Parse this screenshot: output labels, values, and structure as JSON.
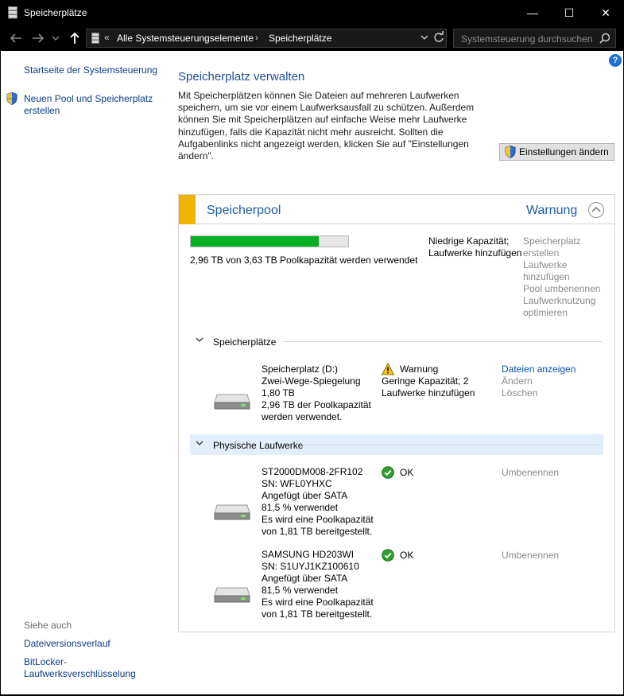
{
  "window": {
    "title": "Speicherplätze",
    "minimize_glyph": "—",
    "maximize_glyph": "☐",
    "close_glyph": "✕"
  },
  "address": {
    "overflow": "«",
    "crumbs": [
      "Alle Systemsteuerungselemente",
      "Speicherplätze"
    ],
    "search_placeholder": "Systemsteuerung durchsuchen"
  },
  "sidebar": {
    "home_link": "Startseite der Systemsteuerung",
    "new_pool_link_line1": "Neuen Pool und Speicherplatz",
    "new_pool_link_line2": "erstellen",
    "see_also": "Siehe auch",
    "links": [
      "Dateiversionsverlauf",
      "BitLocker-",
      "Laufwerksverschlüsselung"
    ]
  },
  "help": "?",
  "main": {
    "title": "Speicherplatz verwalten",
    "intro_lines": [
      "Mit Speicherplätzen können Sie Dateien auf mehreren Laufwerken",
      "speichern, um sie vor einem Laufwerksausfall zu schützen. Außerdem",
      "können Sie mit Speicherplätzen auf einfache Weise mehr Laufwerke",
      "hinzufügen, falls die Kapazität nicht mehr ausreicht. Sollten die",
      "Aufgabenlinks nicht angezeigt werden, klicken Sie auf \"Einstellungen",
      "ändern\"."
    ],
    "settings_button": "Einstellungen ändern"
  },
  "pool": {
    "name": "Speicherpool",
    "status": "Warnung",
    "usage_fraction": 0.815,
    "usage_text": "2,96 TB von 3,63 TB Poolkapazität werden verwendet",
    "warning_lines": [
      "Niedrige Kapazität;",
      "Laufwerke hinzufügen"
    ],
    "actions": [
      "Speicherplatz",
      "erstellen",
      "Laufwerke",
      "hinzufügen",
      "Pool umbenennen",
      "Laufwerknutzung",
      "optimieren"
    ]
  },
  "spaces": {
    "header": "Speicherplätze",
    "items": [
      {
        "lines": [
          "Speicherplatz (D:)",
          "Zwei-Wege-Spiegelung",
          "1,80 TB",
          "2,96 TB der Poolkapazität",
          "werden verwendet."
        ],
        "status": "Warnung",
        "status_detail": [
          "Geringe Kapazität; 2",
          "Laufwerke hinzufügen"
        ],
        "links": [
          "Dateien anzeigen",
          "Ändern",
          "Löschen"
        ]
      }
    ]
  },
  "physical": {
    "header": "Physische Laufwerke",
    "items": [
      {
        "lines": [
          "ST2000DM008-2FR102",
          "SN: WFL0YHXC",
          "Angefügt über SATA",
          "81,5 % verwendet",
          "Es wird eine Poolkapazität",
          "von 1,81 TB bereitgestellt."
        ],
        "status": "OK",
        "link": "Umbenennen"
      },
      {
        "lines": [
          "SAMSUNG HD203WI",
          "SN: S1UYJ1KZ100610",
          "Angefügt über SATA",
          "81,5 % verwendet",
          "Es wird eine Poolkapazität",
          "von 1,81 TB bereitgestellt."
        ],
        "status": "OK",
        "link": "Umbenennen"
      }
    ]
  },
  "colors": {
    "accent": "#1e5cab",
    "warning_stripe": "#f0b400",
    "progress": "#06b025",
    "highlight": "#e2eefb"
  }
}
